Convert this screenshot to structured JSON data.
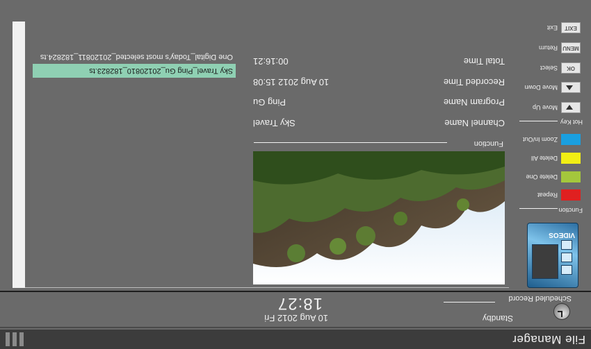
{
  "window": {
    "title": "File Manager"
  },
  "status": {
    "scheduled_record": "Scheduled Record",
    "standby": "Standby",
    "date": "10 Aug 2012 Fri",
    "time": "18:27"
  },
  "files": [
    {
      "name": "Sky Travel_Ping Gu_20120810_182823.ts",
      "selected": true
    },
    {
      "name": "One Digital_Today's most selected_20120811_182824.ts",
      "selected": false
    }
  ],
  "preview": {
    "icon": "landscape-thumbnail"
  },
  "info": {
    "function_title": "Function",
    "channel_name": {
      "label": "Channel Name",
      "value": "Sky Travel"
    },
    "program_name": {
      "label": "Program Name",
      "value": "Ping Gu"
    },
    "recorded_time": {
      "label": "Recorded Time",
      "value": "10 Aug 2012 15:08"
    },
    "total_time": {
      "label": "Total Time",
      "value": "00:16:21"
    }
  },
  "hotkeys": {
    "function_title": "Function",
    "hotkey_title": "Hot Key",
    "colors": [
      {
        "color": "#e02020",
        "label": "Repeat"
      },
      {
        "color": "#a4c73c",
        "label": "Delete One"
      },
      {
        "color": "#f2ee14",
        "label": "Delete All"
      },
      {
        "color": "#1a9fe0",
        "label": "Zoom In/Out"
      }
    ],
    "keys": [
      {
        "key": "▼",
        "label": "Move Up"
      },
      {
        "key": "▲",
        "label": "Move Down"
      },
      {
        "key": "OK",
        "label": "Select"
      },
      {
        "key": "MENU",
        "label": "Return"
      },
      {
        "key": "EXIT",
        "label": "Exit"
      }
    ]
  },
  "promo": {
    "text": "VIDEOS"
  }
}
